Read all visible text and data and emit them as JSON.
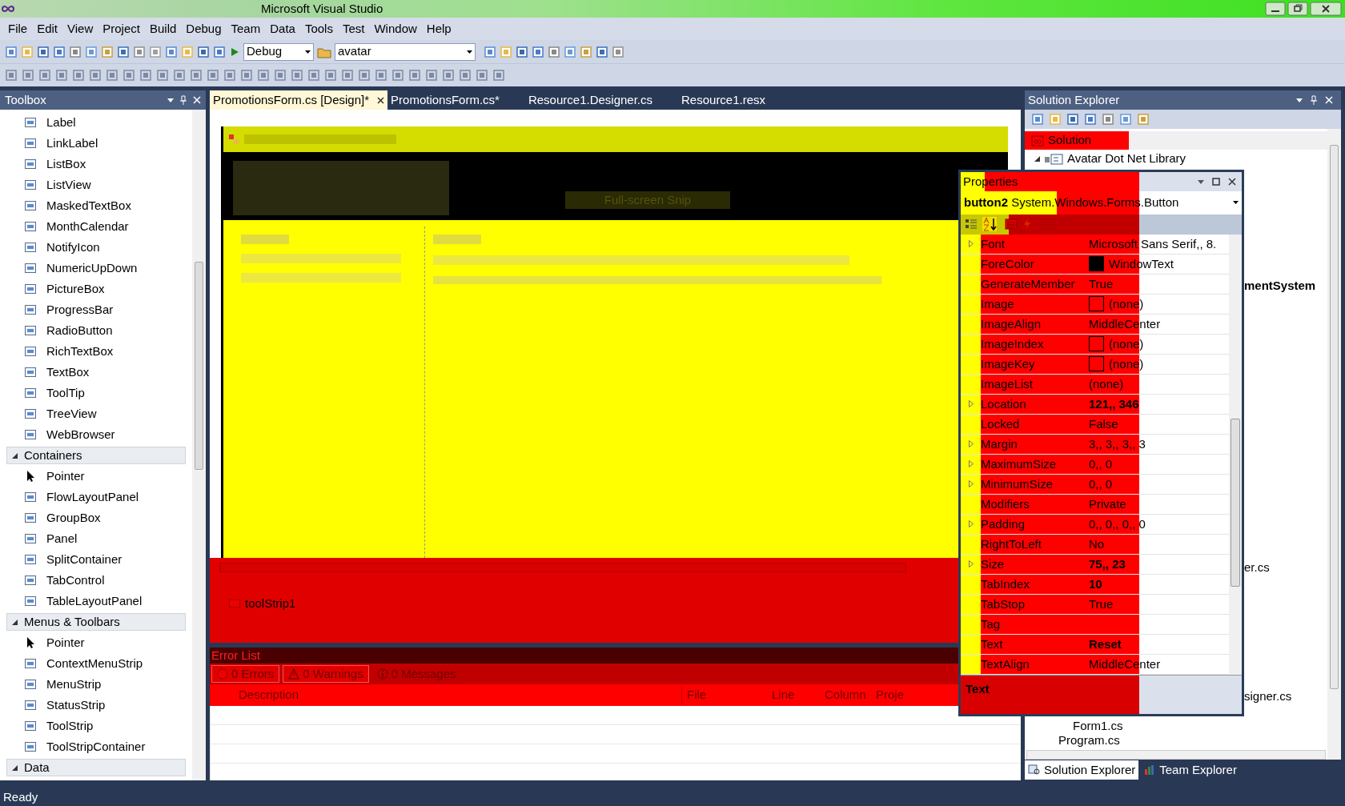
{
  "window": {
    "title": "Microsoft Visual Studio"
  },
  "menu": [
    "File",
    "Edit",
    "View",
    "Project",
    "Build",
    "Debug",
    "Team",
    "Data",
    "Tools",
    "Test",
    "Window",
    "Help"
  ],
  "toolbar": {
    "configuration": "Debug",
    "startup_project": "avatar"
  },
  "toolbox": {
    "title": "Toolbox",
    "items": [
      {
        "kind": "item",
        "label": "Label"
      },
      {
        "kind": "item",
        "label": "LinkLabel"
      },
      {
        "kind": "item",
        "label": "ListBox"
      },
      {
        "kind": "item",
        "label": "ListView"
      },
      {
        "kind": "item",
        "label": "MaskedTextBox"
      },
      {
        "kind": "item",
        "label": "MonthCalendar"
      },
      {
        "kind": "item",
        "label": "NotifyIcon"
      },
      {
        "kind": "item",
        "label": "NumericUpDown"
      },
      {
        "kind": "item",
        "label": "PictureBox"
      },
      {
        "kind": "item",
        "label": "ProgressBar"
      },
      {
        "kind": "item",
        "label": "RadioButton"
      },
      {
        "kind": "item",
        "label": "RichTextBox"
      },
      {
        "kind": "item",
        "label": "TextBox"
      },
      {
        "kind": "item",
        "label": "ToolTip"
      },
      {
        "kind": "item",
        "label": "TreeView"
      },
      {
        "kind": "item",
        "label": "WebBrowser"
      },
      {
        "kind": "category",
        "label": "Containers"
      },
      {
        "kind": "pointer",
        "label": "Pointer"
      },
      {
        "kind": "item",
        "label": "FlowLayoutPanel"
      },
      {
        "kind": "item",
        "label": "GroupBox"
      },
      {
        "kind": "item",
        "label": "Panel"
      },
      {
        "kind": "item",
        "label": "SplitContainer"
      },
      {
        "kind": "item",
        "label": "TabControl"
      },
      {
        "kind": "item",
        "label": "TableLayoutPanel"
      },
      {
        "kind": "category",
        "label": "Menus & Toolbars"
      },
      {
        "kind": "pointer",
        "label": "Pointer"
      },
      {
        "kind": "item",
        "label": "ContextMenuStrip"
      },
      {
        "kind": "item",
        "label": "MenuStrip"
      },
      {
        "kind": "item",
        "label": "StatusStrip"
      },
      {
        "kind": "item",
        "label": "ToolStrip"
      },
      {
        "kind": "item",
        "label": "ToolStripContainer"
      },
      {
        "kind": "category",
        "label": "Data"
      }
    ]
  },
  "editor_tabs": [
    {
      "label": "PromotionsForm.cs [Design]*",
      "selected": true
    },
    {
      "label": "PromotionsForm.cs*",
      "selected": false
    },
    {
      "label": "Resource1.Designer.cs",
      "selected": false
    },
    {
      "label": "Resource1.resx",
      "selected": false
    }
  ],
  "designer": {
    "snip_label": "Full-screen Snip",
    "tool_strip": "toolStrip1"
  },
  "error_list": {
    "title": "Error List",
    "filters": [
      {
        "kind": "error",
        "label": "0 Errors"
      },
      {
        "kind": "warning",
        "label": "0 Warnings"
      },
      {
        "kind": "message",
        "label": "0 Messages"
      }
    ],
    "columns": [
      "Description",
      "File",
      "Line",
      "Column",
      "Proje"
    ]
  },
  "solution_explorer": {
    "title": "Solution Explorer",
    "tree": [
      {
        "kind": "solution",
        "label": "Solution",
        "selected": true
      },
      {
        "kind": "project",
        "label": "Avatar Dot Net Library",
        "selected": false
      }
    ],
    "covered_items": [
      {
        "label": "mentSystem",
        "bold": true
      },
      {
        "label": "er.cs",
        "bold": false
      },
      {
        "label": "signer.cs",
        "bold": false
      },
      {
        "label": "Form1.cs",
        "bold": false
      },
      {
        "label": "Program.cs",
        "bold": false
      }
    ],
    "tabs": [
      {
        "label": "Solution Explorer",
        "selected": true
      },
      {
        "label": "Team Explorer",
        "selected": false
      }
    ]
  },
  "properties": {
    "title": "Properties",
    "object_name": "button2",
    "object_type": "System.Windows.Forms.Button",
    "rows": [
      {
        "name": "Font",
        "value": "Microsoft Sans Serif,, 8.",
        "expandable": true,
        "bold": false
      },
      {
        "name": "ForeColor",
        "value": "WindowText",
        "expandable": false,
        "bold": false,
        "kind": "color"
      },
      {
        "name": "GenerateMember",
        "value": "True",
        "expandable": false,
        "bold": false
      },
      {
        "name": "Image",
        "value": "(none)",
        "expandable": false,
        "bold": false,
        "kind": "image"
      },
      {
        "name": "ImageAlign",
        "value": "MiddleCenter",
        "expandable": false,
        "bold": false
      },
      {
        "name": "ImageIndex",
        "value": "(none)",
        "expandable": false,
        "bold": false,
        "kind": "image"
      },
      {
        "name": "ImageKey",
        "value": "(none)",
        "expandable": false,
        "bold": false,
        "kind": "image"
      },
      {
        "name": "ImageList",
        "value": "(none)",
        "expandable": false,
        "bold": false
      },
      {
        "name": "Location",
        "value": "121,, 346",
        "expandable": true,
        "bold": true
      },
      {
        "name": "Locked",
        "value": "False",
        "expandable": false,
        "bold": false
      },
      {
        "name": "Margin",
        "value": "3,, 3,, 3,, 3",
        "expandable": true,
        "bold": false
      },
      {
        "name": "MaximumSize",
        "value": "0,, 0",
        "expandable": true,
        "bold": false
      },
      {
        "name": "MinimumSize",
        "value": "0,, 0",
        "expandable": true,
        "bold": false
      },
      {
        "name": "Modifiers",
        "value": "Private",
        "expandable": false,
        "bold": false
      },
      {
        "name": "Padding",
        "value": "0,, 0,, 0,, 0",
        "expandable": true,
        "bold": false
      },
      {
        "name": "RightToLeft",
        "value": "No",
        "expandable": false,
        "bold": false
      },
      {
        "name": "Size",
        "value": "75,, 23",
        "expandable": true,
        "bold": true
      },
      {
        "name": "TabIndex",
        "value": "10",
        "expandable": false,
        "bold": true
      },
      {
        "name": "TabStop",
        "value": "True",
        "expandable": false,
        "bold": false
      },
      {
        "name": "Tag",
        "expandable": false
      },
      {
        "name": "Text",
        "value": "Reset",
        "expandable": false,
        "bold": true
      },
      {
        "name": "TextAlign",
        "value": "MiddleCenter",
        "expandable": false,
        "bold": false
      }
    ],
    "description_title": "Text"
  },
  "status_bar": "Ready"
}
